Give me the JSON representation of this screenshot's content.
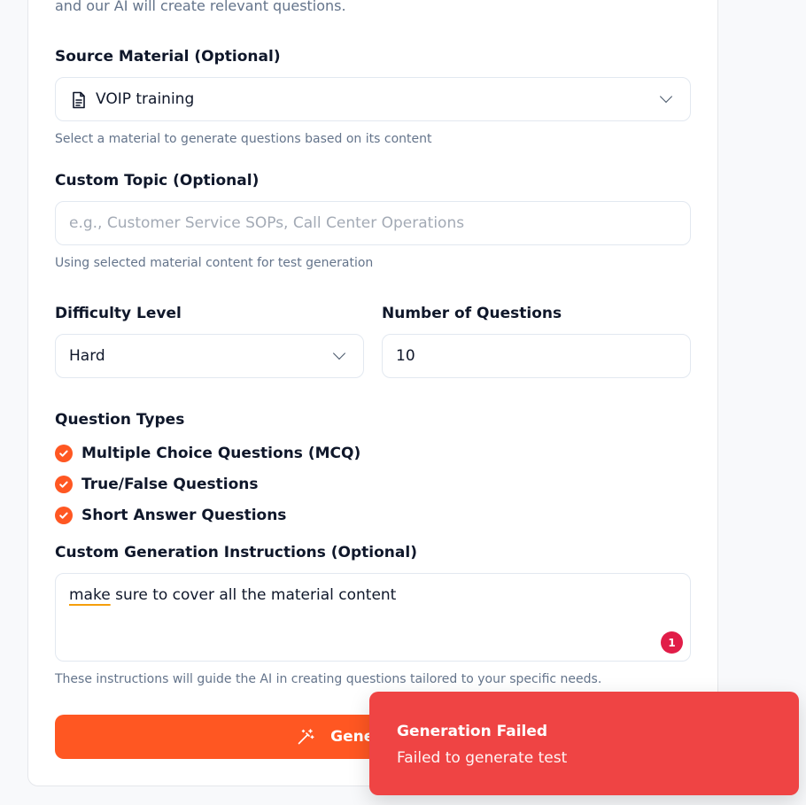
{
  "form": {
    "intro_text": "and our AI will create relevant questions.",
    "source_material": {
      "label": "Source Material (Optional)",
      "value": "VOIP training",
      "icon": "document-icon",
      "hint": "Select a material to generate questions based on its content"
    },
    "custom_topic": {
      "label": "Custom Topic (Optional)",
      "placeholder": "e.g., Customer Service SOPs, Call Center Operations",
      "value": "",
      "hint": "Using selected material content for test generation"
    },
    "difficulty": {
      "label": "Difficulty Level",
      "value": "Hard"
    },
    "num_questions": {
      "label": "Number of Questions",
      "value": "10"
    },
    "question_types": {
      "label": "Question Types",
      "items": [
        {
          "label": "Multiple Choice Questions (MCQ)",
          "checked": true
        },
        {
          "label": "True/False Questions",
          "checked": true
        },
        {
          "label": "Short Answer Questions",
          "checked": true
        }
      ]
    },
    "instructions": {
      "label": "Custom Generation Instructions (Optional)",
      "value_first_word": "make",
      "value_rest": " sure to cover all the material content",
      "badge_count": "1",
      "hint": "These instructions will guide the AI in creating questions tailored to your specific needs."
    },
    "generate_button": {
      "label": "Generate Test",
      "icon": "magic-wand-icon"
    }
  },
  "toast": {
    "title": "Generation Failed",
    "message": "Failed to generate test"
  },
  "colors": {
    "accent": "#ff5722",
    "error": "#ef4444",
    "badge": "#e11d48"
  }
}
